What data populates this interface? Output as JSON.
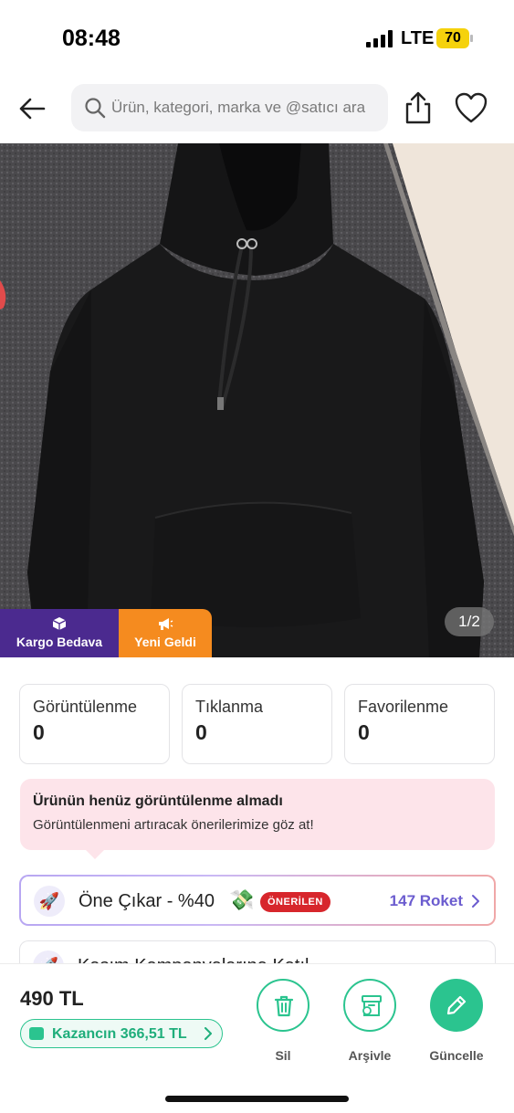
{
  "status_bar": {
    "time": "08:48",
    "network": "LTE",
    "battery": "70"
  },
  "nav": {
    "search_placeholder": "Ürün, kategori, marka ve @satıcı ara",
    "icons": [
      "back-arrow-icon",
      "search-icon",
      "share-icon",
      "heart-icon"
    ]
  },
  "product": {
    "image_pager": "1/2",
    "badges": {
      "kargo": "Kargo Bedava",
      "yeni": "Yeni Geldi"
    }
  },
  "stats": [
    {
      "label": "Görüntülenme",
      "value": "0"
    },
    {
      "label": "Tıklanma",
      "value": "0"
    },
    {
      "label": "Favorilenme",
      "value": "0"
    }
  ],
  "notice": {
    "title": "Ürünün henüz görüntülenme almadı",
    "text": "Görüntülenmeni artıracak önerilerimize göz at!"
  },
  "promo": {
    "label": "Öne Çıkar - %40",
    "tag": "ÖNERİLEN",
    "cost": "147 Roket"
  },
  "promo2": {
    "label": "Kasım Kampanyalarına Katıl"
  },
  "bottom": {
    "price": "490 TL",
    "earnings": "Kazancın 366,51 TL",
    "actions": {
      "delete": "Sil",
      "archive": "Arşivle",
      "update": "Güncelle"
    }
  },
  "colors": {
    "purple": "#4b2a8f",
    "orange": "#f58b1f",
    "green": "#2bc48f",
    "red": "#d7262c",
    "roket": "#6b5ccf"
  }
}
